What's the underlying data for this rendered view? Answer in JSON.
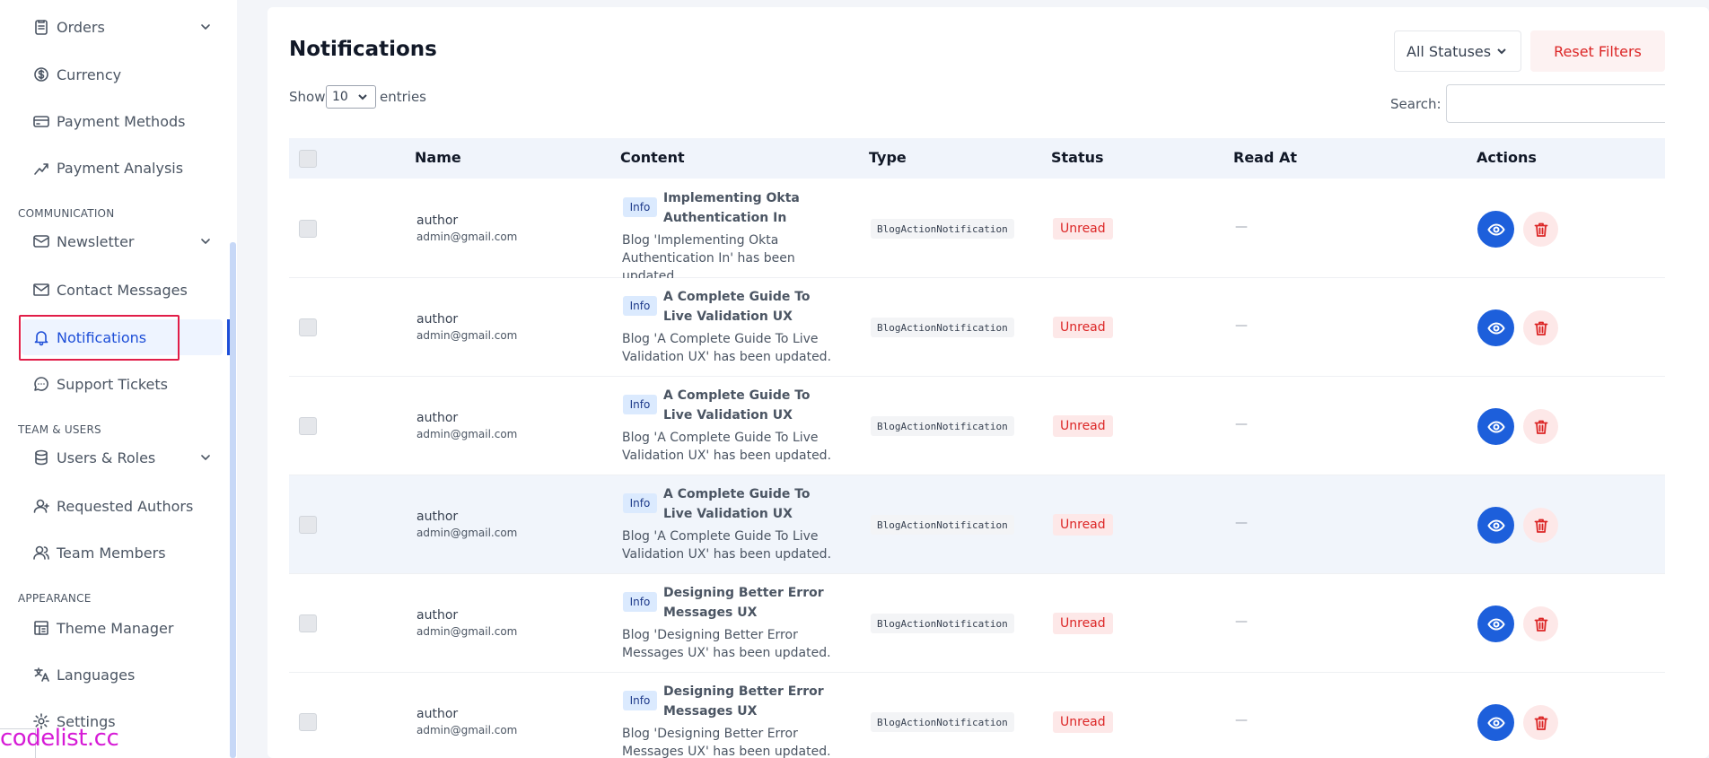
{
  "sidebar": {
    "items": [
      {
        "label": "Orders",
        "icon": "orders-icon",
        "has_chevron": true
      },
      {
        "label": "Currency",
        "icon": "currency-icon"
      },
      {
        "label": "Payment Methods",
        "icon": "credit-card-icon"
      },
      {
        "label": "Payment Analysis",
        "icon": "chart-icon"
      },
      {
        "label": "Newsletter",
        "icon": "mail-icon",
        "has_chevron": true
      },
      {
        "label": "Contact Messages",
        "icon": "envelope-icon"
      },
      {
        "label": "Notifications",
        "icon": "bell-icon",
        "active": true
      },
      {
        "label": "Support Tickets",
        "icon": "chat-icon"
      },
      {
        "label": "Users & Roles",
        "icon": "database-icon",
        "has_chevron": true
      },
      {
        "label": "Requested Authors",
        "icon": "user-icon"
      },
      {
        "label": "Team Members",
        "icon": "users-icon"
      },
      {
        "label": "Theme Manager",
        "icon": "palette-icon"
      },
      {
        "label": "Languages",
        "icon": "translate-icon"
      },
      {
        "label": "Settings",
        "icon": "gear-icon"
      }
    ],
    "sections": {
      "communication": "COMMUNICATION",
      "team_users": "TEAM & USERS",
      "appearance": "APPEARANCE"
    },
    "highlight_color": "#e11d48",
    "active_color": "#1d4ed8"
  },
  "watermark": "codelist.cc",
  "main": {
    "title": "Notifications",
    "status_filter": "All Statuses",
    "reset_label": "Reset Filters",
    "show_label": "Show",
    "entries_value": "10",
    "entries_label": "entries",
    "search_label": "Search:",
    "columns": [
      "Name",
      "Content",
      "Type",
      "Status",
      "Read At",
      "Actions"
    ],
    "rows": [
      {
        "name": "author",
        "email": "admin@gmail.com",
        "badge": "Info",
        "title": "Implementing Okta Authentication In",
        "message": "Blog 'Implementing Okta Authentication In' has been updated.",
        "type": "BlogActionNotification",
        "status": "Unread",
        "read_at": "—"
      },
      {
        "name": "author",
        "email": "admin@gmail.com",
        "badge": "Info",
        "title": "A Complete Guide To Live Validation UX",
        "message": "Blog 'A Complete Guide To Live Validation UX' has been updated.",
        "type": "BlogActionNotification",
        "status": "Unread",
        "read_at": "—"
      },
      {
        "name": "author",
        "email": "admin@gmail.com",
        "badge": "Info",
        "title": "A Complete Guide To Live Validation UX",
        "message": "Blog 'A Complete Guide To Live Validation UX' has been updated.",
        "type": "BlogActionNotification",
        "status": "Unread",
        "read_at": "—"
      },
      {
        "name": "author",
        "email": "admin@gmail.com",
        "badge": "Info",
        "title": "A Complete Guide To Live Validation UX",
        "message": "Blog 'A Complete Guide To Live Validation UX' has been updated.",
        "type": "BlogActionNotification",
        "status": "Unread",
        "read_at": "—"
      },
      {
        "name": "author",
        "email": "admin@gmail.com",
        "badge": "Info",
        "title": "Designing Better Error Messages UX",
        "message": "Blog 'Designing Better Error Messages UX' has been updated.",
        "type": "BlogActionNotification",
        "status": "Unread",
        "read_at": "—"
      },
      {
        "name": "author",
        "email": "admin@gmail.com",
        "badge": "Info",
        "title": "Designing Better Error Messages UX",
        "message": "Blog 'Designing Better Error Messages UX' has been updated.",
        "type": "BlogActionNotification",
        "status": "Unread",
        "read_at": "—"
      }
    ],
    "colors": {
      "primary": "#1d5fdb",
      "danger": "#dc2626",
      "info_bg": "#dbeafe"
    }
  }
}
